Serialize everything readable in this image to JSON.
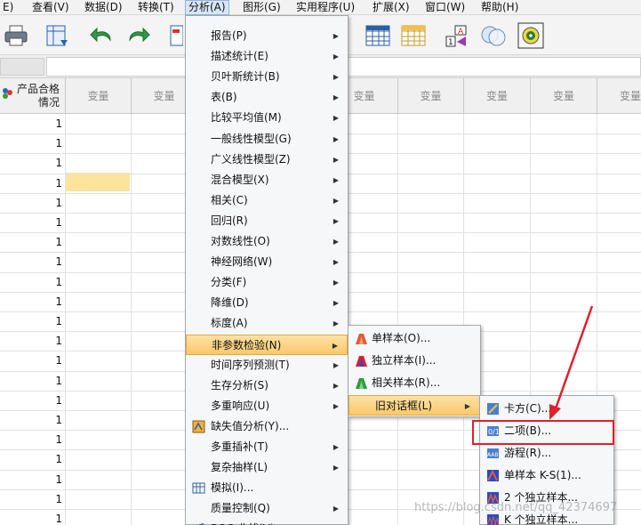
{
  "menubar": {
    "items": [
      "E)",
      "查看(V)",
      "数据(D)",
      "转换(T)",
      "分析(A)",
      "图形(G)",
      "实用程序(U)",
      "扩展(X)",
      "窗口(W)",
      "帮助(H)"
    ]
  },
  "grid": {
    "first_header": "产品合格\n情况",
    "col_header": "变量",
    "row_value": "1"
  },
  "analyze_menu": {
    "items": [
      {
        "label": "报告(P)",
        "submenu": true
      },
      {
        "label": "描述统计(E)",
        "submenu": true
      },
      {
        "label": "贝叶斯统计(B)",
        "submenu": true
      },
      {
        "label": "表(B)",
        "submenu": true
      },
      {
        "label": "比较平均值(M)",
        "submenu": true
      },
      {
        "label": "一般线性模型(G)",
        "submenu": true
      },
      {
        "label": "广义线性模型(Z)",
        "submenu": true
      },
      {
        "label": "混合模型(X)",
        "submenu": true
      },
      {
        "label": "相关(C)",
        "submenu": true
      },
      {
        "label": "回归(R)",
        "submenu": true
      },
      {
        "label": "对数线性(O)",
        "submenu": true
      },
      {
        "label": "神经网络(W)",
        "submenu": true
      },
      {
        "label": "分类(F)",
        "submenu": true
      },
      {
        "label": "降维(D)",
        "submenu": true
      },
      {
        "label": "标度(A)",
        "submenu": true
      },
      {
        "label": "非参数检验(N)",
        "submenu": true
      },
      {
        "label": "时间序列预测(T)",
        "submenu": true
      },
      {
        "label": "生存分析(S)",
        "submenu": true
      },
      {
        "label": "多重响应(U)",
        "submenu": true
      },
      {
        "label": "缺失值分析(Y)...",
        "submenu": false
      },
      {
        "label": "多重插补(T)",
        "submenu": true
      },
      {
        "label": "复杂抽样(L)",
        "submenu": true
      },
      {
        "label": "模拟(I)...",
        "submenu": false
      },
      {
        "label": "质量控制(Q)",
        "submenu": true
      },
      {
        "label": "ROC 曲线(V)...",
        "submenu": false
      }
    ]
  },
  "nonparam_menu": {
    "items": [
      "单样本(O)...",
      "独立样本(I)...",
      "相关样本(R)...",
      "旧对话框(L)"
    ]
  },
  "legacy_menu": {
    "items": [
      "卡方(C)...",
      "二项(B)...",
      "游程(R)...",
      "单样本 K-S(1)...",
      "2 个独立样本...",
      "K 个独立样本..."
    ]
  },
  "watermark": "https://blog.csdn.net/qq_42374697",
  "colors": {
    "highlight": "#f9c86b",
    "annotation": "#e0202b",
    "selected_cell": "#fde49c"
  }
}
